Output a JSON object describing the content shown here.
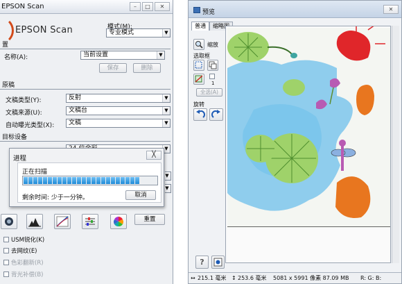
{
  "left_window": {
    "title": "EPSON Scan",
    "brand": "EPSON Scan",
    "mode_label": "模式(M):",
    "mode_value": "专业模式",
    "section_settings_header": "置",
    "name_label": "名称(A):",
    "name_value": "当前设置",
    "save_button": "保存",
    "delete_button": "删除",
    "section_original": "原稿",
    "doc_type_label": "文稿类型(Y):",
    "doc_type_value": "反射",
    "doc_source_label": "文稿来源(U):",
    "doc_source_value": "文稿台",
    "auto_exposure_label": "自动曝光类型(X):",
    "auto_exposure_value": "文稿",
    "section_target": "目标设备",
    "image_type_value": "24-位全彩",
    "reset_button": "重置",
    "checkboxes": [
      {
        "label": "USM锐化(K)",
        "disabled": false
      },
      {
        "label": "去网纹(E)",
        "disabled": false
      },
      {
        "label": "色彩翻新(R)",
        "disabled": true
      },
      {
        "label": "背光补偿(B)",
        "disabled": true
      }
    ]
  },
  "progress_dialog": {
    "title": "进程",
    "close_glyph": "╳",
    "status": "正在扫描",
    "segments_filled": 24,
    "remaining": "剩余时间: 少于一分钟。",
    "cancel_button": "取消"
  },
  "right_window": {
    "title": "预览",
    "tab_normal": "普通",
    "tab_thumb": "缩略图",
    "zoom_label": "缩放",
    "marquee_group": "选取框",
    "marquee_count": "1",
    "select_all": "全选(A)",
    "rotate_group": "旋转",
    "help_glyph": "?",
    "status_width": "215.1 毫米",
    "status_height": "253.6 毫米",
    "status_pixels": "5081 x 5991 像素 87.09 MB",
    "status_rgb": "R: G: B:"
  },
  "colors": {
    "accent": "#1f8ad6",
    "water": "#7cc6ec",
    "leaf": "#9fd26a",
    "red_flower": "#e0262a",
    "orange": "#e8761f",
    "purple": "#b85bb3"
  }
}
